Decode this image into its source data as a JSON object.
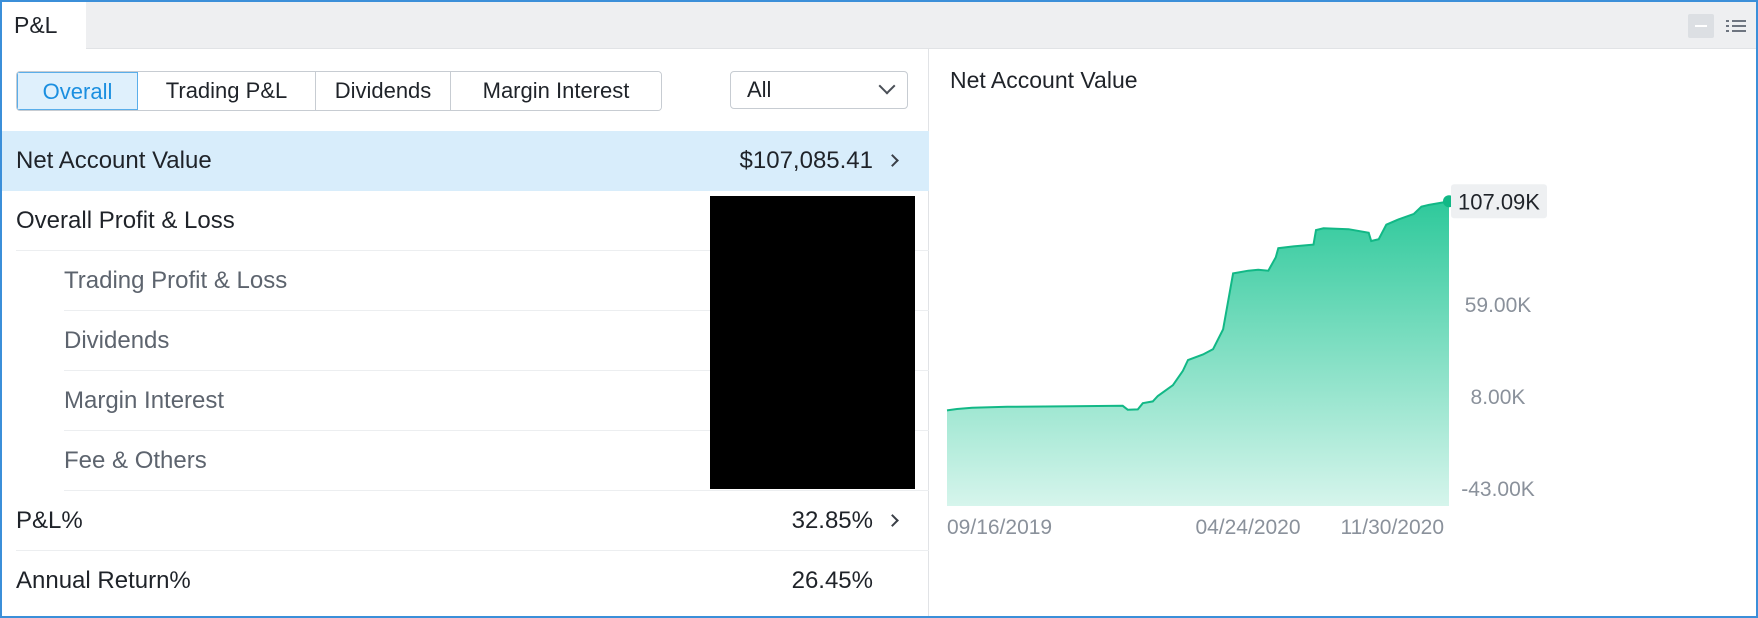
{
  "header": {
    "tab_label": "P&L",
    "icons": [
      "minimize-icon",
      "list-menu-icon"
    ]
  },
  "filters": {
    "tabs": [
      {
        "label": "Overall",
        "active": true
      },
      {
        "label": "Trading P&L",
        "active": false
      },
      {
        "label": "Dividends",
        "active": false
      },
      {
        "label": "Margin Interest",
        "active": false
      }
    ],
    "period_selected": "All"
  },
  "summary": {
    "net_account_value": {
      "label": "Net Account Value",
      "value": "$107,085.41"
    },
    "overall_pl": {
      "label": "Overall Profit & Loss"
    },
    "trading_pl": {
      "label": "Trading Profit & Loss"
    },
    "dividends": {
      "label": "Dividends"
    },
    "margin_interest": {
      "label": "Margin Interest"
    },
    "fee_others": {
      "label": "Fee & Others"
    },
    "pl_percent": {
      "label": "P&L%",
      "value": "32.85%"
    },
    "annual_return": {
      "label": "Annual Return%",
      "value": "26.45%"
    }
  },
  "chart": {
    "title": "Net Account Value",
    "current_label": "107.09K",
    "colors": {
      "line": "#12b886",
      "fill_top": "#2ec99b",
      "fill_bottom": "#d6f5ec",
      "badge_bg": "#eef0f2"
    }
  },
  "chart_data": {
    "type": "area",
    "title": "Net Account Value",
    "x_tick_labels": [
      "09/16/2019",
      "04/24/2020",
      "11/30/2020"
    ],
    "y_tick_labels": [
      "59.00K",
      "8.00K",
      "-43.00K"
    ],
    "y_ticks": [
      59000,
      8000,
      -43000
    ],
    "ylim": [
      -53000,
      145000
    ],
    "x_range": [
      0,
      1
    ],
    "series": [
      {
        "values": [
          [
            0.0,
            0.0
          ],
          [
            0.02,
            0.8
          ],
          [
            0.05,
            1.5
          ],
          [
            0.12,
            2.0
          ],
          [
            0.25,
            2.3
          ],
          [
            0.35,
            2.6
          ],
          [
            0.36,
            0.4
          ],
          [
            0.38,
            0.6
          ],
          [
            0.39,
            4.0
          ],
          [
            0.41,
            5.0
          ],
          [
            0.42,
            8.0
          ],
          [
            0.45,
            14.0
          ],
          [
            0.47,
            22.0
          ],
          [
            0.48,
            28.0
          ],
          [
            0.51,
            31.0
          ],
          [
            0.53,
            34.0
          ],
          [
            0.55,
            45.0
          ],
          [
            0.57,
            76.0
          ],
          [
            0.58,
            76.5
          ],
          [
            0.6,
            77.5
          ],
          [
            0.62,
            78.0
          ],
          [
            0.64,
            77.5
          ],
          [
            0.655,
            85.0
          ],
          [
            0.66,
            90.0
          ],
          [
            0.69,
            91.0
          ],
          [
            0.71,
            91.5
          ],
          [
            0.73,
            92.0
          ],
          [
            0.735,
            100.0
          ],
          [
            0.75,
            101.0
          ],
          [
            0.8,
            100.5
          ],
          [
            0.84,
            98.5
          ],
          [
            0.845,
            94.0
          ],
          [
            0.86,
            95.0
          ],
          [
            0.875,
            103.0
          ],
          [
            0.9,
            106.0
          ],
          [
            0.93,
            109.0
          ],
          [
            0.945,
            113.0
          ],
          [
            0.96,
            114.0
          ],
          [
            0.98,
            115.0
          ],
          [
            1.0,
            116.0
          ]
        ]
      }
    ],
    "grid": false
  }
}
